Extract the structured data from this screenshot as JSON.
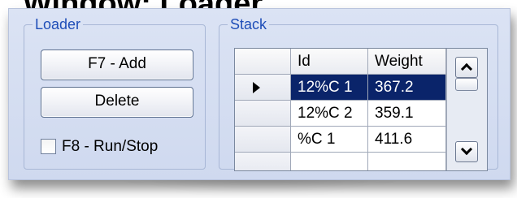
{
  "window": {
    "title": "Window: Loader"
  },
  "loader": {
    "group_title": "Loader",
    "add_label": "F7 - Add",
    "delete_label": "Delete",
    "run_stop_label": "F8 - Run/Stop",
    "run_stop_checked": false
  },
  "stack": {
    "group_title": "Stack",
    "columns": [
      "",
      "Id",
      "Weight"
    ],
    "rows": [
      {
        "id": "12%C 1",
        "weight": "367.2",
        "selected": true
      },
      {
        "id": "12%C 2",
        "weight": "359.1",
        "selected": false
      },
      {
        "id": "%C 1",
        "weight": "411.6",
        "selected": false
      }
    ]
  },
  "colors": {
    "panel_background": "#d6def2",
    "group_title": "#1f4eb8",
    "selection": "#0a246a"
  }
}
